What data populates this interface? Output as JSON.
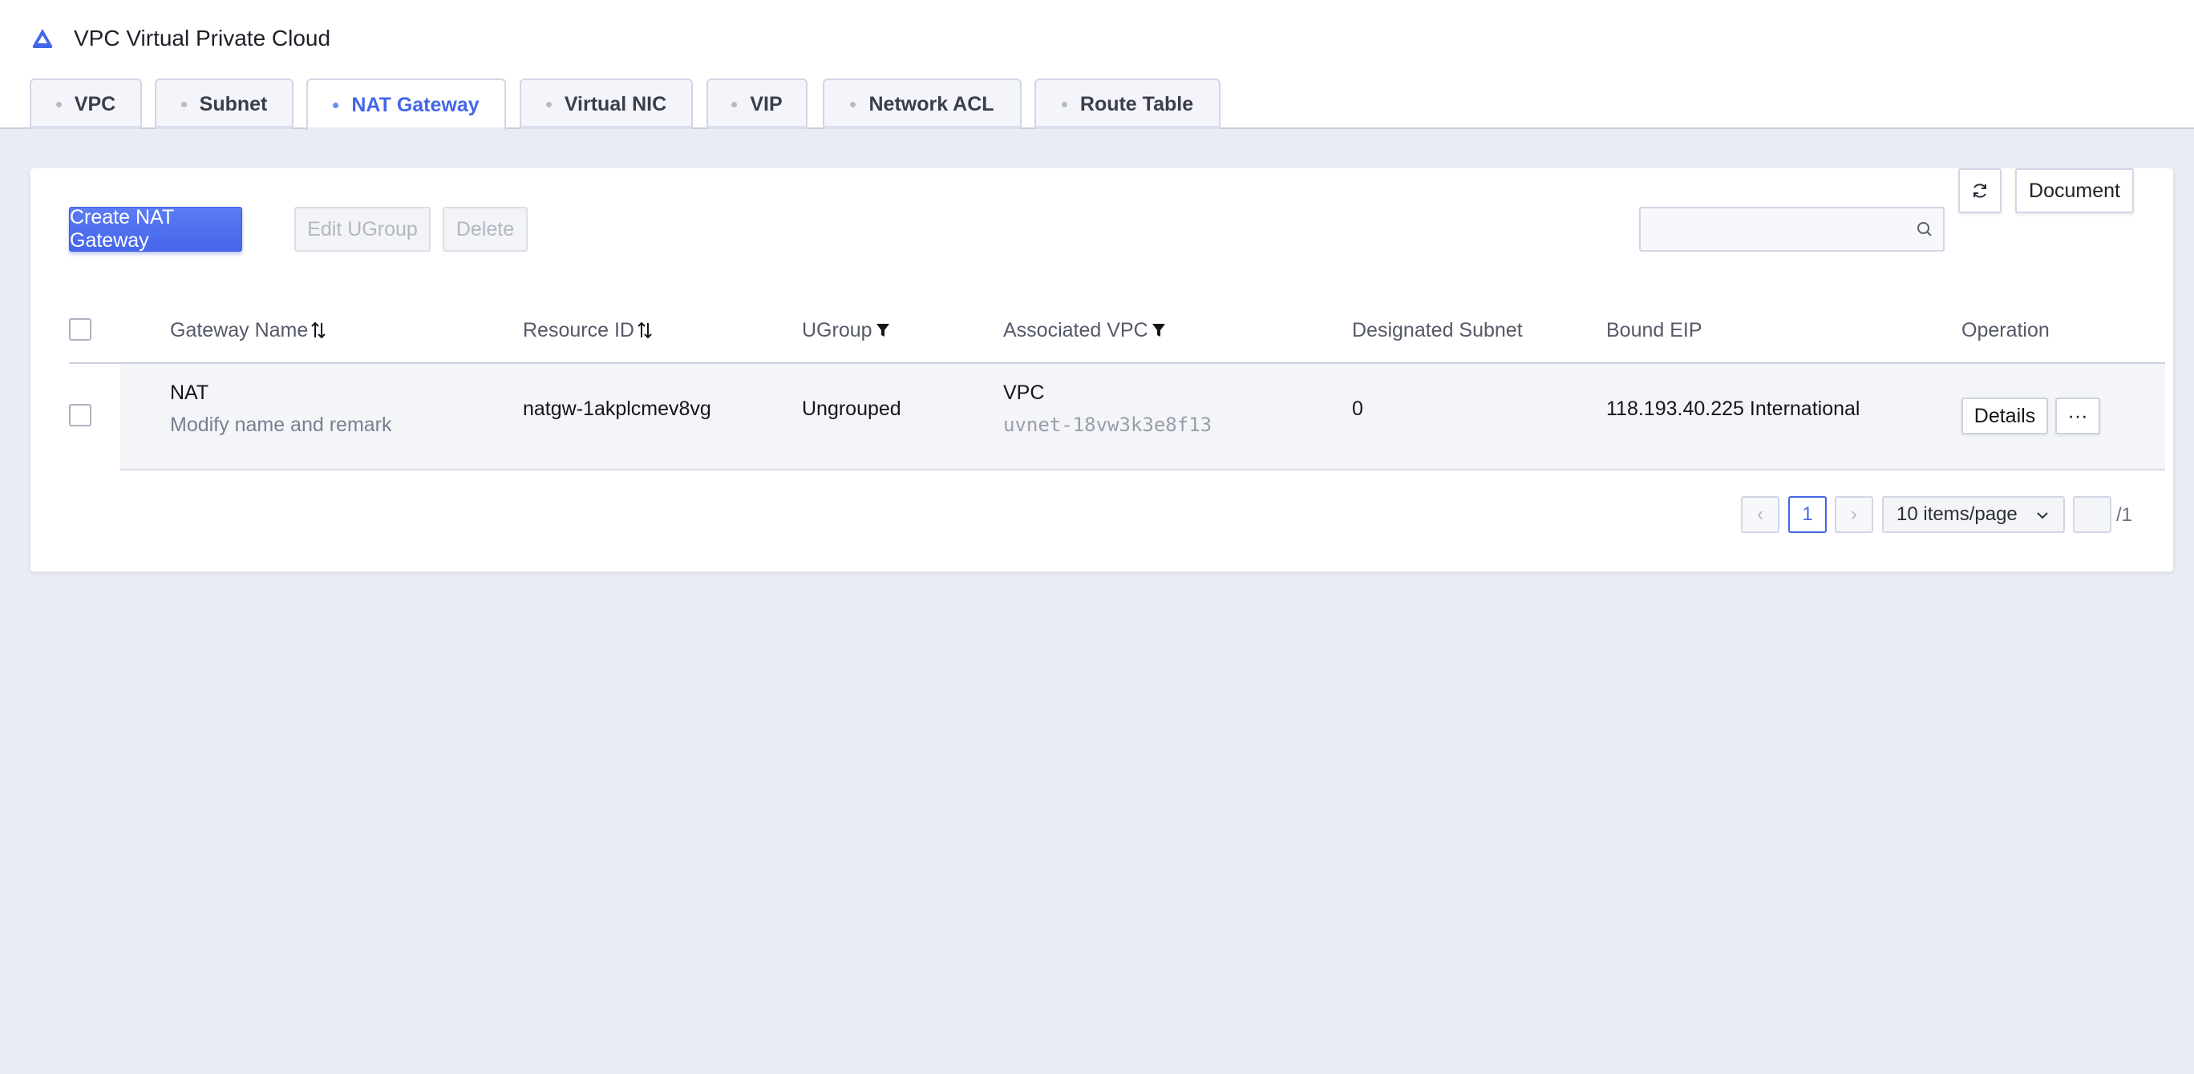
{
  "header": {
    "title": "VPC Virtual Private Cloud",
    "tabs": [
      {
        "label": "VPC"
      },
      {
        "label": "Subnet"
      },
      {
        "label": "NAT Gateway"
      },
      {
        "label": "Virtual NIC"
      },
      {
        "label": "VIP"
      },
      {
        "label": "Network ACL"
      },
      {
        "label": "Route Table"
      }
    ],
    "active_tab": "NAT Gateway"
  },
  "toolbar": {
    "create_label": "Create NAT Gateway",
    "edit_ugroup_label": "Edit UGroup",
    "delete_label": "Delete",
    "search_placeholder": "",
    "document_label": "Document"
  },
  "table": {
    "columns": [
      {
        "label": "Gateway Name",
        "icon": "sort-icon"
      },
      {
        "label": "Resource ID",
        "icon": "sort-icon"
      },
      {
        "label": "UGroup",
        "icon": "filter-icon"
      },
      {
        "label": "Associated VPC",
        "icon": "filter-icon"
      },
      {
        "label": "Designated Subnet"
      },
      {
        "label": "Bound EIP"
      },
      {
        "label": "Operation"
      }
    ],
    "rows": [
      {
        "name": "NAT",
        "remark": "Modify name and remark",
        "resource_id": "natgw-1akplcmev8vg",
        "ugroup": "Ungrouped",
        "vpc_name": "VPC",
        "vpc_id": "uvnet-18vw3k3e8f13",
        "subnet": "0",
        "eip": "118.193.40.225 International",
        "details_label": "Details",
        "more_label": "···"
      }
    ]
  },
  "pagination": {
    "prev": "‹",
    "current_page": "1",
    "next": "›",
    "page_size": "10 items/page",
    "jump_value": "",
    "total": "/1"
  },
  "colors": {
    "accent": "#4466e8",
    "background": "#eaecf4"
  }
}
